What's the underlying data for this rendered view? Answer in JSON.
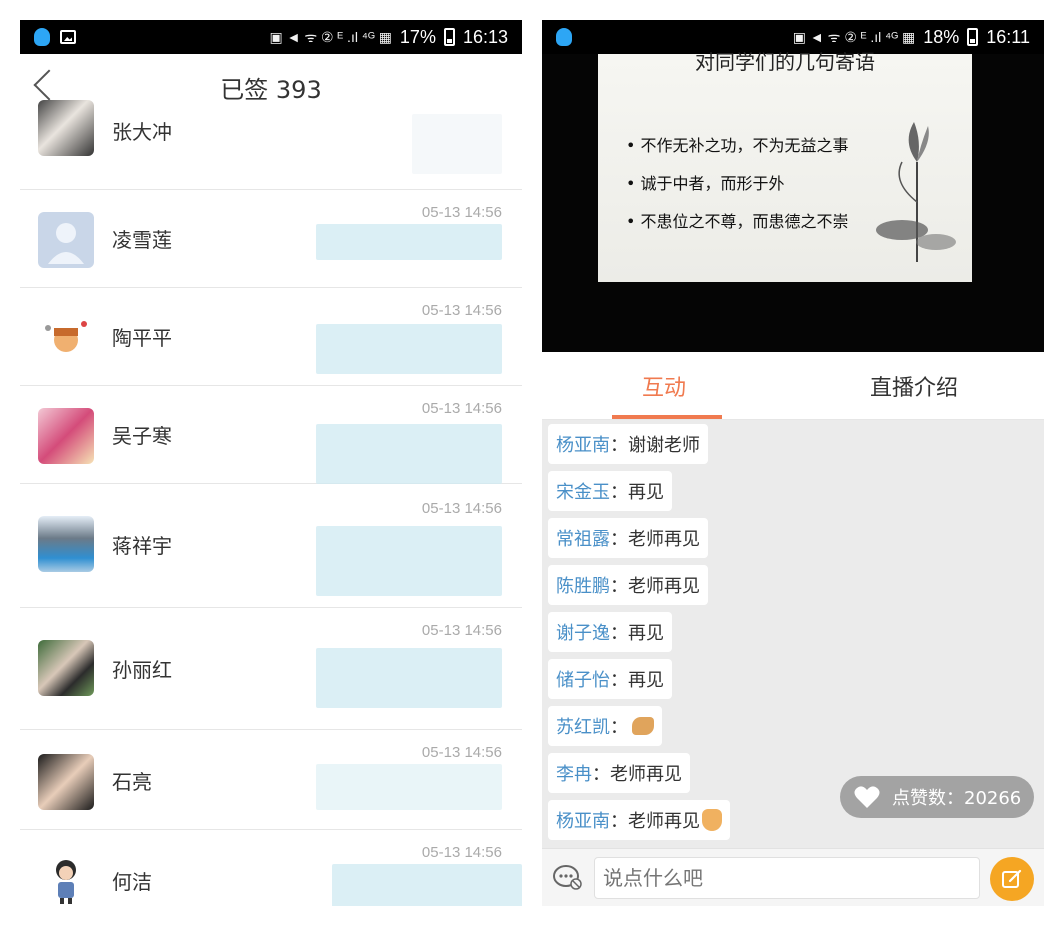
{
  "left": {
    "status_bar": {
      "battery": "17%",
      "time": "16:13"
    },
    "nav": {
      "title": "已签 393"
    },
    "rows": [
      {
        "name": "张大冲",
        "time": ""
      },
      {
        "name": "凌雪莲",
        "time": "05-13 14:56"
      },
      {
        "name": "陶平平",
        "time": "05-13 14:56"
      },
      {
        "name": "吴子寒",
        "time": "05-13 14:56"
      },
      {
        "name": "蒋祥宇",
        "time": "05-13 14:56"
      },
      {
        "name": "孙丽红",
        "time": "05-13 14:56"
      },
      {
        "name": "石亮",
        "time": "05-13 14:56"
      },
      {
        "name": "何洁",
        "time": "05-13 14:56"
      }
    ]
  },
  "right": {
    "status_bar": {
      "battery": "18%",
      "time": "16:11"
    },
    "slide": {
      "title": "对同学们的几句寄语",
      "lines": [
        "• 不作无补之功，不为无益之事",
        "• 诚于中者，而形于外",
        "• 不患位之不尊，而患德之不崇"
      ]
    },
    "tabs": {
      "active": "互动",
      "other": "直播介绍"
    },
    "messages": [
      {
        "user": "杨亚南",
        "text": "：谢谢老师",
        "emoji": ""
      },
      {
        "user": "宋金玉",
        "text": "：再见",
        "emoji": ""
      },
      {
        "user": "常祖露",
        "text": "：老师再见",
        "emoji": ""
      },
      {
        "user": "陈胜鹏",
        "text": "：老师再见",
        "emoji": ""
      },
      {
        "user": "谢子逸",
        "text": "：再见",
        "emoji": ""
      },
      {
        "user": "储子怡",
        "text": "：再见",
        "emoji": ""
      },
      {
        "user": "苏红凯",
        "text": "：",
        "emoji": "clap-hand-emoji"
      },
      {
        "user": "李冉",
        "text": "：老师再见",
        "emoji": ""
      },
      {
        "user": "杨亚南",
        "text": "：老师再见",
        "emoji": "wave-hand-emoji"
      }
    ],
    "likes": {
      "label": "点赞数：20266"
    },
    "composer": {
      "placeholder": "说点什么吧"
    },
    "colors": {
      "accent": "#f07a4f",
      "username": "#4a90c8",
      "send": "#f5a623"
    }
  }
}
